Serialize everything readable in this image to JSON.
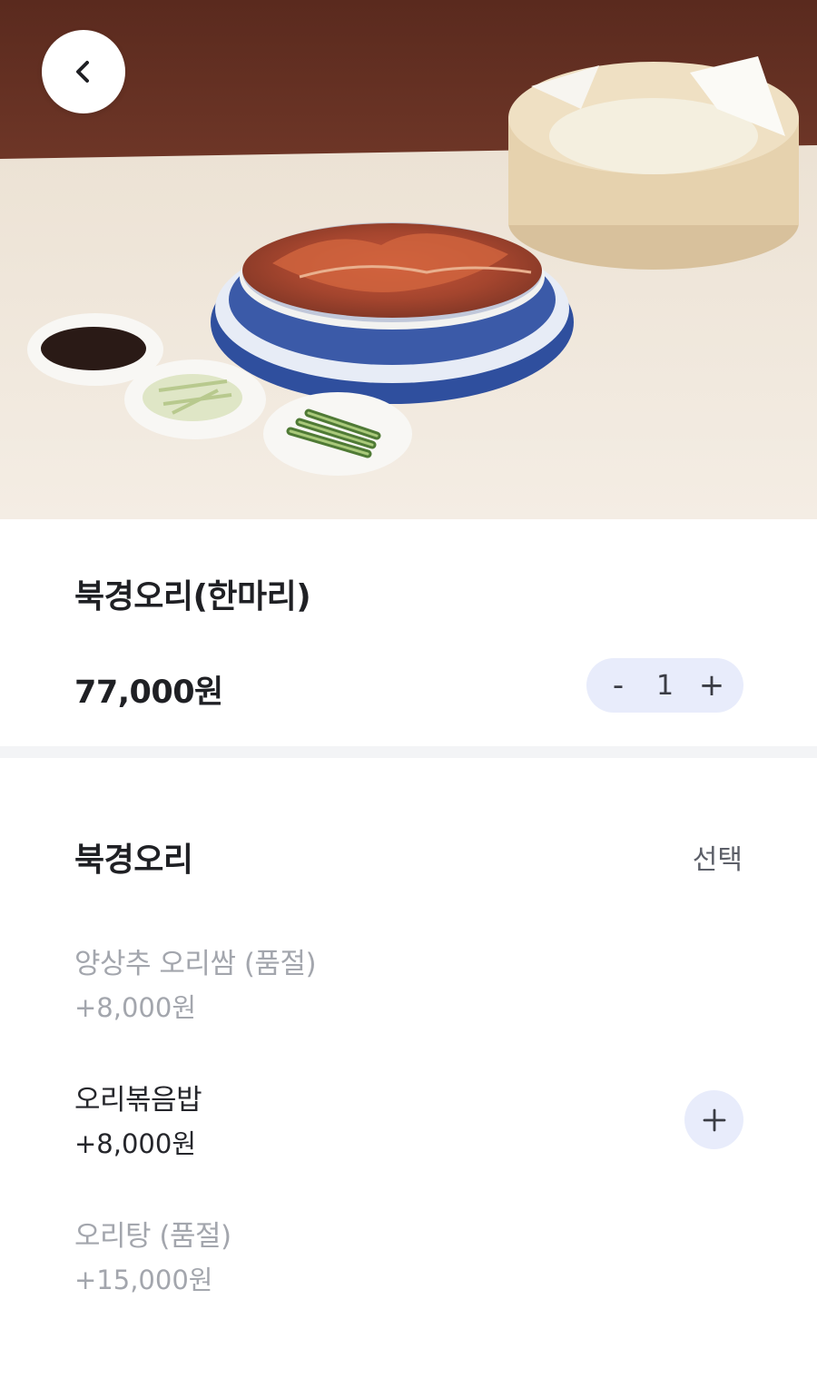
{
  "header": {
    "back_icon": "chevron-left-icon"
  },
  "product": {
    "image_description_icon": "photo",
    "name": "북경오리(한마리)",
    "price": "77,000원",
    "quantity": "1",
    "decrement_label": "-",
    "increment_label": "+"
  },
  "options": {
    "group_title": "북경오리",
    "group_badge": "선택",
    "items": [
      {
        "name": "양상추 오리쌈 (품절)",
        "price": "+8,000원",
        "sold_out": true
      },
      {
        "name": "오리볶음밥",
        "price": "+8,000원",
        "sold_out": false
      },
      {
        "name": "오리탕 (품절)",
        "price": "+15,000원",
        "sold_out": true
      }
    ],
    "add_icon": "plus-icon"
  },
  "colors": {
    "stepper_bg": "#e8ecfb",
    "sold_out_text": "#a3a6ad",
    "primary_text": "#1f2024",
    "divider": "#f3f4f6"
  }
}
